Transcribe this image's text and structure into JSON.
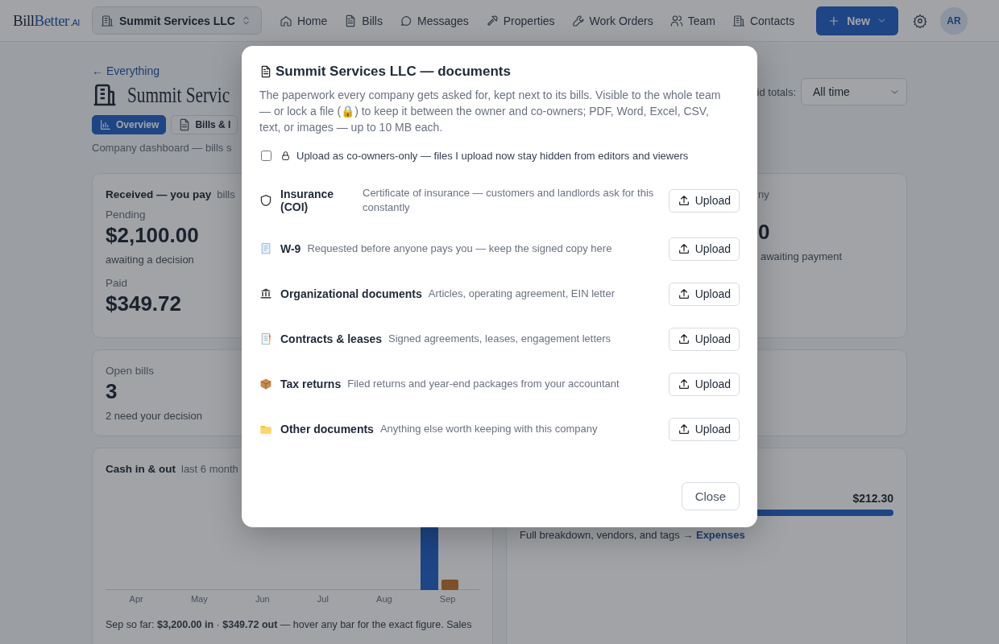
{
  "header": {
    "logo": {
      "first": "Bill",
      "second": "Better",
      "suffix": ".AI"
    },
    "company": "Summit Services LLC",
    "nav": [
      {
        "label": "Home"
      },
      {
        "label": "Bills"
      },
      {
        "label": "Messages"
      },
      {
        "label": "Properties"
      },
      {
        "label": "Work Orders"
      },
      {
        "label": "Team"
      },
      {
        "label": "Contacts"
      }
    ],
    "new_button": "New",
    "avatar": "AR"
  },
  "page": {
    "back_link": "← Everything",
    "title": "Summit Servic",
    "tabs": [
      {
        "label": "Overview",
        "selected": true
      },
      {
        "label": "Bills & I",
        "selected": false
      }
    ],
    "subtitle": "Company dashboard — bills s",
    "totals_label": "id totals:",
    "totals_select": "All time"
  },
  "received": {
    "title": "Received — you pay",
    "note": "bills",
    "pending_label": "Pending",
    "pending_amount": "$2,100.00",
    "pending_note": "awaiting a decision",
    "paid_label": "Paid",
    "paid_amount": "$349.72"
  },
  "sent": {
    "note": "ny",
    "amount": "0",
    "amount_note": "awaiting payment"
  },
  "open_bills": {
    "label": "Open bills",
    "count": "3",
    "note": "2 need your decision"
  },
  "cash": {
    "title": "Cash in & out",
    "note": "last 6 month",
    "months": [
      "Apr",
      "May",
      "Jun",
      "Jul",
      "Aug",
      "Sep"
    ],
    "summary": "Sep so far: **$3,200.00 in** · **$349.72 out** — hover any bar for the exact figure. Sales"
  },
  "expenses": {
    "amount": "$212.30",
    "footer": "Full breakdown, vendors, and tags →",
    "link": "Expenses"
  },
  "modal": {
    "title": "Summit Services LLC — documents",
    "description": "The paperwork every company gets asked for, kept next to its bills. Visible to the whole team — or lock a file (🔒) to keep it between the owner and co-owners; PDF, Word, Excel, CSV, text, or images — up to 10 MB each.",
    "checkbox": {
      "label": "Upload as co-owners-only — files I upload now stay hidden from editors and viewers",
      "checked": false
    },
    "documents": [
      {
        "name": "Insurance (COI)",
        "description": "Certificate of insurance — customers and landlords ask for this constantly",
        "action": "Upload"
      },
      {
        "name": "W-9",
        "description": "Requested before anyone pays you — keep the signed copy here",
        "action": "Upload"
      },
      {
        "name": "Organizational documents",
        "description": "Articles, operating agreement, EIN letter",
        "action": "Upload"
      },
      {
        "name": "Contracts & leases",
        "description": "Signed agreements, leases, engagement letters",
        "action": "Upload"
      },
      {
        "name": "Tax returns",
        "description": "Filed returns and year-end packages from your accountant",
        "action": "Upload"
      },
      {
        "name": "Other documents",
        "description": "Anything else worth keeping with this company",
        "action": "Upload"
      }
    ],
    "close": "Close"
  }
}
